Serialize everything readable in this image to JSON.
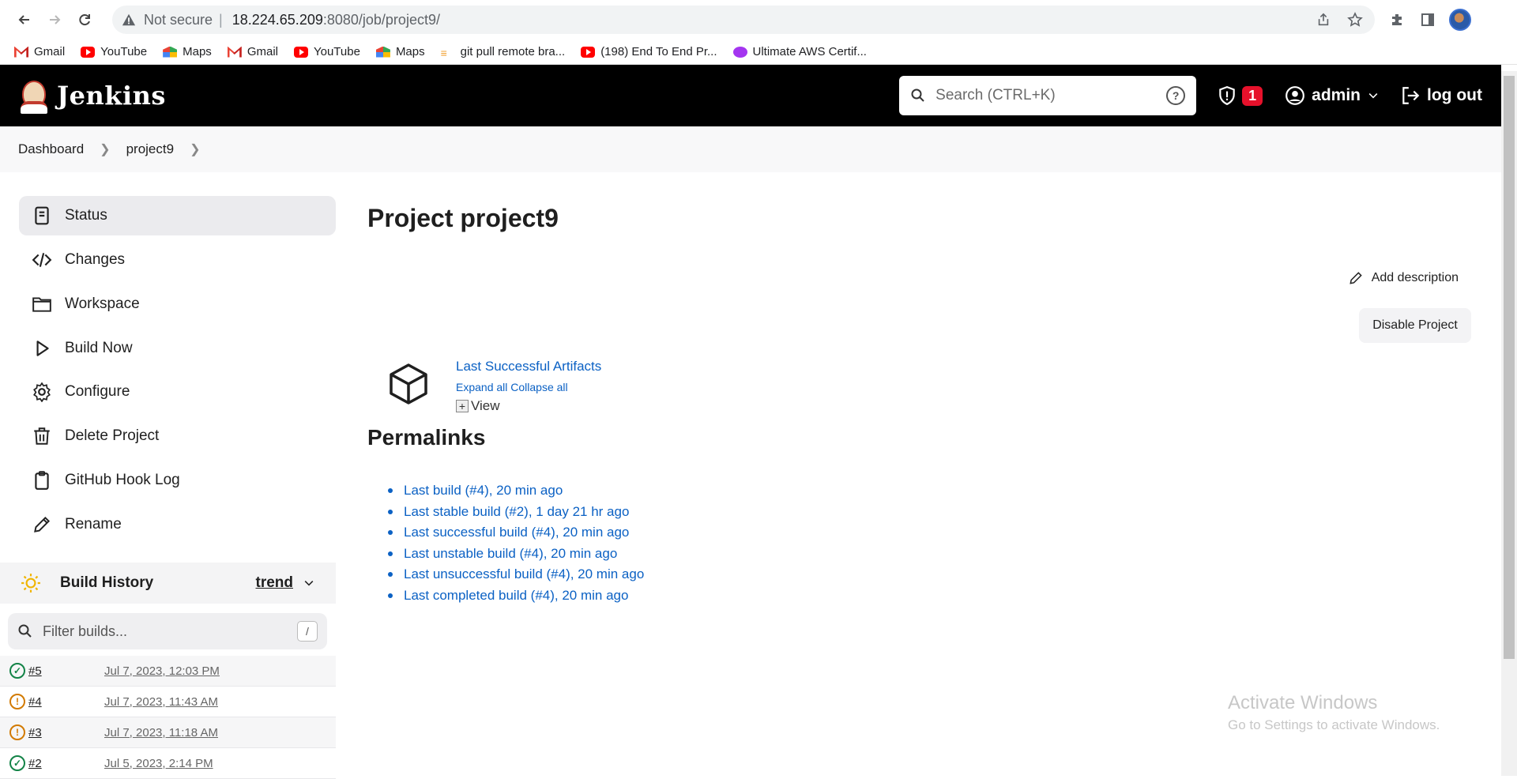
{
  "browser": {
    "url_security": "Not secure",
    "url_host": "18.224.65.209",
    "url_path": ":8080/job/project9/",
    "bookmarks": [
      {
        "label": "Gmail",
        "icon": "gmail-icon"
      },
      {
        "label": "YouTube",
        "icon": "youtube-icon"
      },
      {
        "label": "Maps",
        "icon": "maps-icon"
      },
      {
        "label": "Gmail",
        "icon": "gmail-icon"
      },
      {
        "label": "YouTube",
        "icon": "youtube-icon"
      },
      {
        "label": "Maps",
        "icon": "maps-icon"
      },
      {
        "label": "git pull remote bra...",
        "icon": "stackoverflow-icon"
      },
      {
        "label": "(198) End To End Pr...",
        "icon": "youtube-icon"
      },
      {
        "label": "Ultimate AWS Certif...",
        "icon": "udemy-icon"
      }
    ]
  },
  "header": {
    "brand": "Jenkins",
    "search_placeholder": "Search (CTRL+K)",
    "security_count": "1",
    "user": "admin",
    "logout": "log out"
  },
  "breadcrumb": [
    "Dashboard",
    "project9"
  ],
  "sidebar": {
    "tasks": [
      {
        "label": "Status",
        "icon": "status-icon",
        "active": true
      },
      {
        "label": "Changes",
        "icon": "code-icon"
      },
      {
        "label": "Workspace",
        "icon": "folder-icon"
      },
      {
        "label": "Build Now",
        "icon": "play-icon"
      },
      {
        "label": "Configure",
        "icon": "gear-icon"
      },
      {
        "label": "Delete Project",
        "icon": "trash-icon"
      },
      {
        "label": "GitHub Hook Log",
        "icon": "clipboard-icon"
      },
      {
        "label": "Rename",
        "icon": "pencil-icon"
      }
    ],
    "build_history": {
      "title": "Build History",
      "trend": "trend",
      "filter_placeholder": "Filter builds...",
      "shortcut": "/",
      "builds": [
        {
          "number": "#5",
          "date": "Jul 7, 2023, 12:03 PM",
          "status": "success"
        },
        {
          "number": "#4",
          "date": "Jul 7, 2023, 11:43 AM",
          "status": "unstable"
        },
        {
          "number": "#3",
          "date": "Jul 7, 2023, 11:18 AM",
          "status": "unstable"
        },
        {
          "number": "#2",
          "date": "Jul 5, 2023, 2:14 PM",
          "status": "success"
        }
      ]
    }
  },
  "main": {
    "title": "Project project9",
    "add_description": "Add description",
    "disable_button": "Disable Project",
    "artifacts": {
      "title": "Last Successful Artifacts",
      "expand": "Expand all",
      "collapse": "Collapse all",
      "view": "View"
    },
    "permalinks_title": "Permalinks",
    "permalinks": [
      "Last build (#4), 20 min ago",
      "Last stable build (#2), 1 day 21 hr ago",
      "Last successful build (#4), 20 min ago",
      "Last unstable build (#4), 20 min ago",
      "Last unsuccessful build (#4), 20 min ago",
      "Last completed build (#4), 20 min ago"
    ]
  },
  "watermark": {
    "line1": "Activate Windows",
    "line2": "Go to Settings to activate Windows."
  }
}
